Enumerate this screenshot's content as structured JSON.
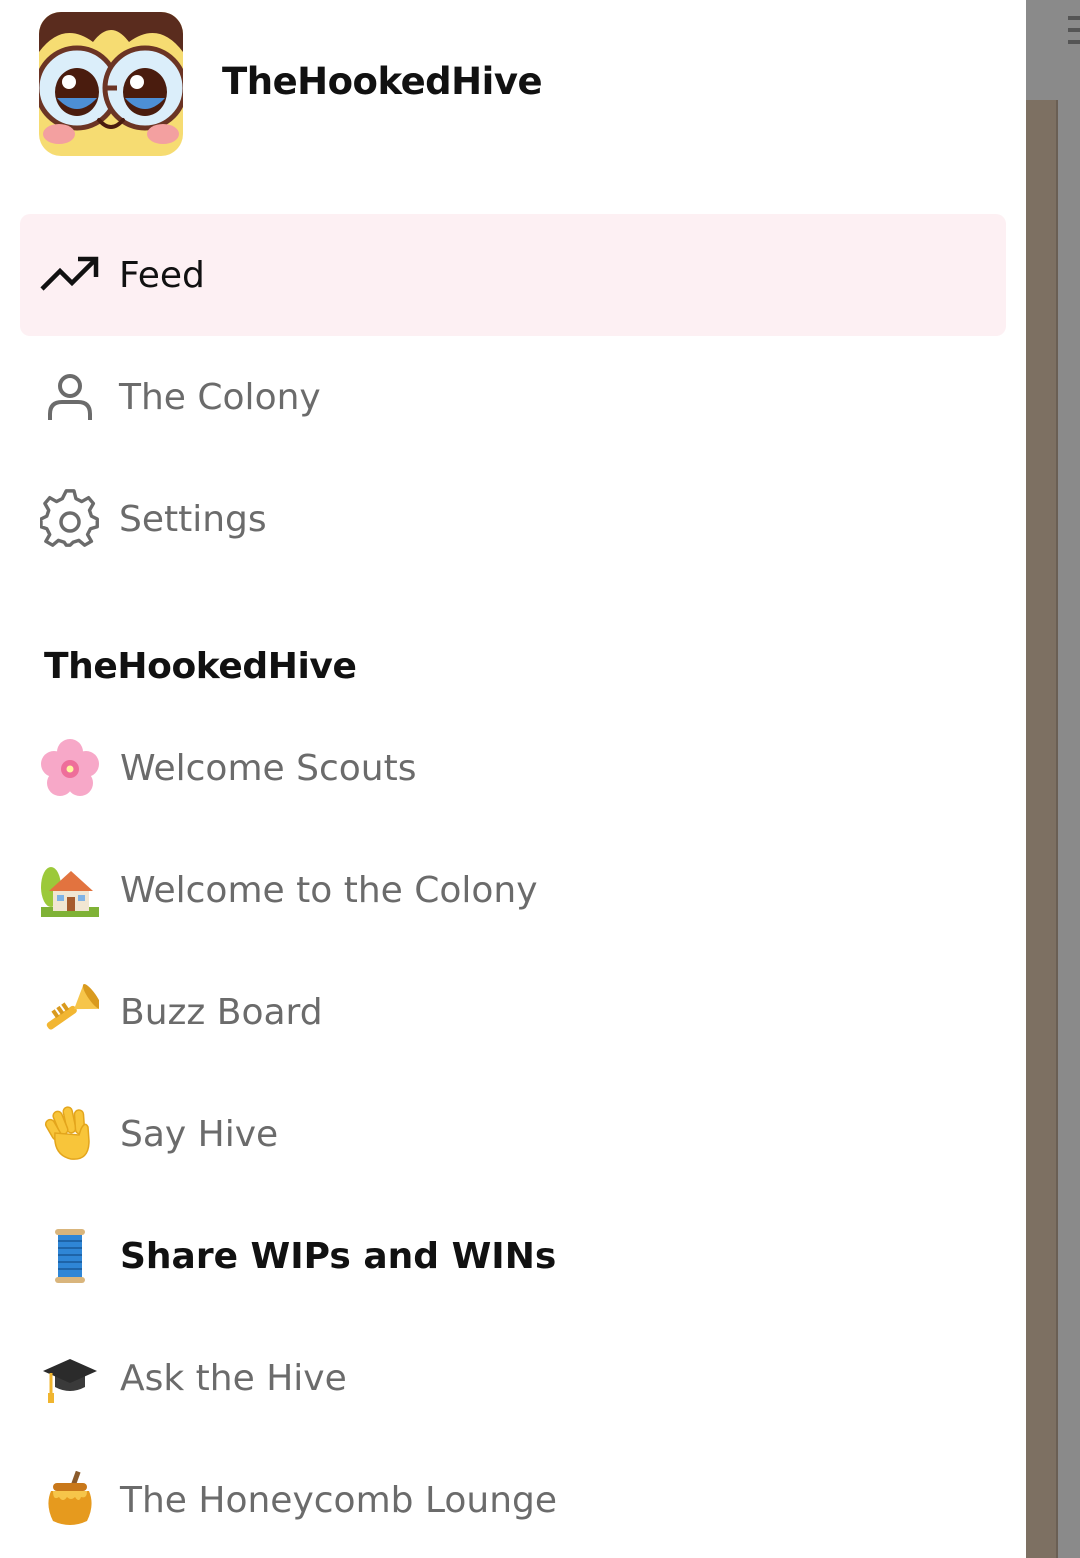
{
  "app": {
    "name": "TheHookedHive",
    "logo_icon": "owl-face-logo"
  },
  "nav": {
    "items": [
      {
        "label": "Feed",
        "icon": "trending-up-icon",
        "active": true
      },
      {
        "label": "The Colony",
        "icon": "user-icon",
        "active": false
      },
      {
        "label": "Settings",
        "icon": "gear-icon",
        "active": false
      }
    ]
  },
  "community": {
    "title": "TheHookedHive",
    "channels": [
      {
        "label": "Welcome Scouts",
        "icon": "cherry-blossom-icon",
        "unread": false
      },
      {
        "label": "Welcome to the Colony",
        "icon": "house-with-garden-icon",
        "unread": false
      },
      {
        "label": "Buzz Board",
        "icon": "trumpet-icon",
        "unread": false
      },
      {
        "label": "Say Hive",
        "icon": "waving-hand-icon",
        "unread": false
      },
      {
        "label": "Share WIPs and WINs",
        "icon": "thread-spool-icon",
        "unread": true
      },
      {
        "label": "Ask the Hive",
        "icon": "graduation-cap-icon",
        "unread": false
      },
      {
        "label": "The Honeycomb Lounge",
        "icon": "honey-pot-icon",
        "unread": false
      }
    ]
  },
  "colors": {
    "active_bg": "#fdf0f3",
    "text_primary": "#111111",
    "text_muted": "#6b6b6b",
    "overlay": "#8a8a8a"
  }
}
